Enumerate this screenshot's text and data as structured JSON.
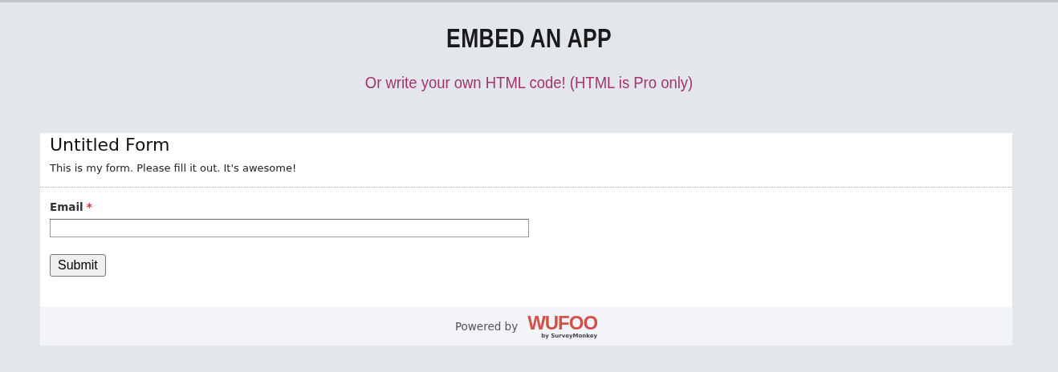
{
  "header": {
    "title": "EMBED AN APP",
    "subtitle": "Or write your own HTML code! (HTML is Pro only)"
  },
  "form": {
    "title": "Untitled Form",
    "description": "This is my form. Please fill it out. It's awesome!",
    "fields": [
      {
        "label": "Email",
        "required_mark": "*",
        "required": true
      }
    ],
    "submit": "Submit"
  },
  "footer": {
    "powered_by": "Powered by",
    "logo": "WUFOO",
    "logo_tagline": "by SurveyMonkey"
  }
}
